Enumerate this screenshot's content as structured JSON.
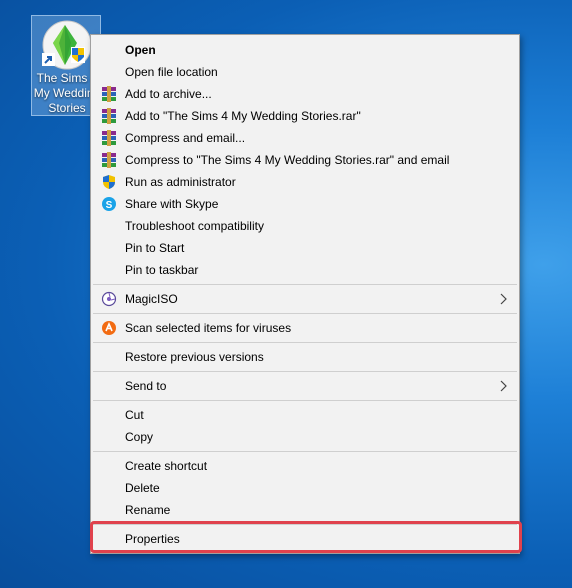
{
  "desktop": {
    "icon": {
      "label": "The Sims 4 My Wedding Stories",
      "name": "sims-plumbob-shortcut-icon"
    }
  },
  "menu": {
    "items": [
      {
        "label": "Open"
      },
      {
        "label": "Open file location"
      },
      {
        "label": "Add to archive...",
        "icon": "winrar-icon"
      },
      {
        "label": "Add to \"The Sims 4 My Wedding Stories.rar\"",
        "icon": "winrar-icon"
      },
      {
        "label": "Compress and email...",
        "icon": "winrar-icon"
      },
      {
        "label": "Compress to \"The Sims 4 My Wedding Stories.rar\" and email",
        "icon": "winrar-icon"
      },
      {
        "label": "Run as administrator",
        "icon": "uac-shield-icon"
      },
      {
        "label": "Share with Skype",
        "icon": "skype-icon"
      },
      {
        "label": "Troubleshoot compatibility"
      },
      {
        "label": "Pin to Start"
      },
      {
        "label": "Pin to taskbar"
      },
      {
        "label": "MagicISO",
        "icon": "magiciso-icon"
      },
      {
        "label": "Scan selected items for viruses",
        "icon": "avast-icon"
      },
      {
        "label": "Restore previous versions"
      },
      {
        "label": "Send to"
      },
      {
        "label": "Cut"
      },
      {
        "label": "Copy"
      },
      {
        "label": "Create shortcut"
      },
      {
        "label": "Delete"
      },
      {
        "label": "Rename"
      },
      {
        "label": "Properties"
      }
    ]
  },
  "colors": {
    "highlight_border": "#e0424d",
    "menu_bg": "#f2f2f2"
  }
}
